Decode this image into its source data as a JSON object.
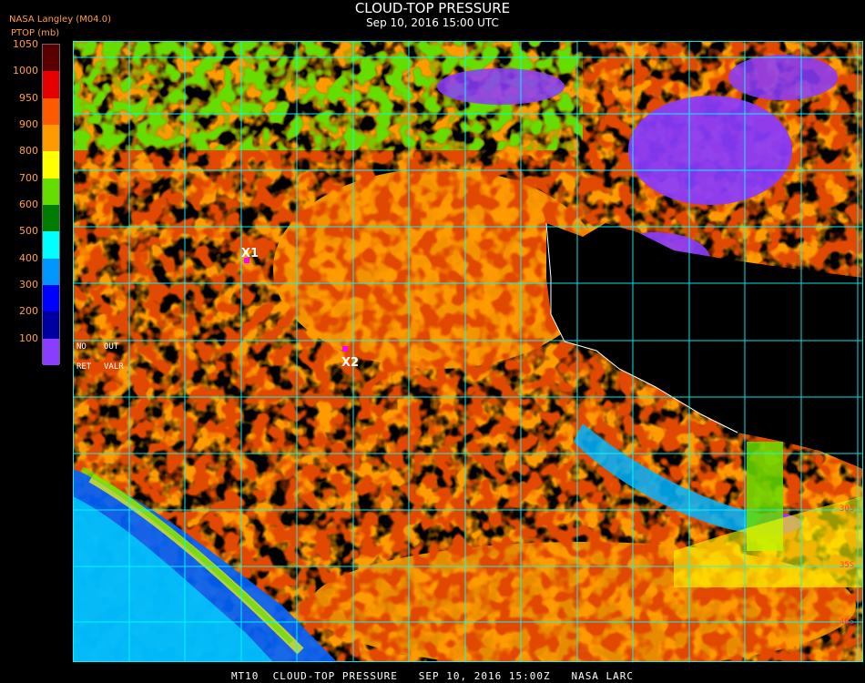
{
  "header": {
    "title": "CLOUD-TOP PRESSURE",
    "subtitle": "Sep 10, 2016 15:00 UTC",
    "provider": "NASA Langley (M04.0)",
    "units_label": "PTOP (mb)"
  },
  "colorbar": {
    "ticks": [
      "1050",
      "1000",
      "950",
      "900",
      "800",
      "700",
      "600",
      "500",
      "400",
      "300",
      "200",
      "100"
    ],
    "segments": [
      {
        "from": 1050,
        "to": 1000,
        "color": "#5a0000"
      },
      {
        "from": 1000,
        "to": 950,
        "color": "#e60000"
      },
      {
        "from": 950,
        "to": 900,
        "color": "#ff5a00"
      },
      {
        "from": 900,
        "to": 800,
        "color": "#ff9a00"
      },
      {
        "from": 800,
        "to": 700,
        "color": "#ffff00"
      },
      {
        "from": 700,
        "to": 600,
        "color": "#66dd00"
      },
      {
        "from": 600,
        "to": 500,
        "color": "#007d00"
      },
      {
        "from": 500,
        "to": 400,
        "color": "#00ffff"
      },
      {
        "from": 400,
        "to": 300,
        "color": "#0096ff"
      },
      {
        "from": 300,
        "to": 200,
        "color": "#0000ff"
      },
      {
        "from": 200,
        "to": 150,
        "color": "#0000a0"
      },
      {
        "from": 150,
        "to": 100,
        "color": "#8a3cff"
      }
    ],
    "range": [
      100,
      1050
    ]
  },
  "legend_codes": {
    "no": "NO",
    "out": "OUT",
    "ret": "RET",
    "valr": "VALR"
  },
  "markers": [
    {
      "label": "X1",
      "color": "#ff00ff"
    },
    {
      "label": "X2",
      "color": "#ff00ff"
    }
  ],
  "lat_labels": [
    "30S",
    "35S",
    "40S"
  ],
  "footer": "MT10  CLOUD-TOP PRESSURE   SEP 10, 2016 15:00Z   NASA LARC",
  "colors": {
    "grid": "#00ffff",
    "background": "#000000",
    "coast": "#ffffff",
    "label_orange": "#ffa040",
    "label_red": "#ff3b3b"
  }
}
